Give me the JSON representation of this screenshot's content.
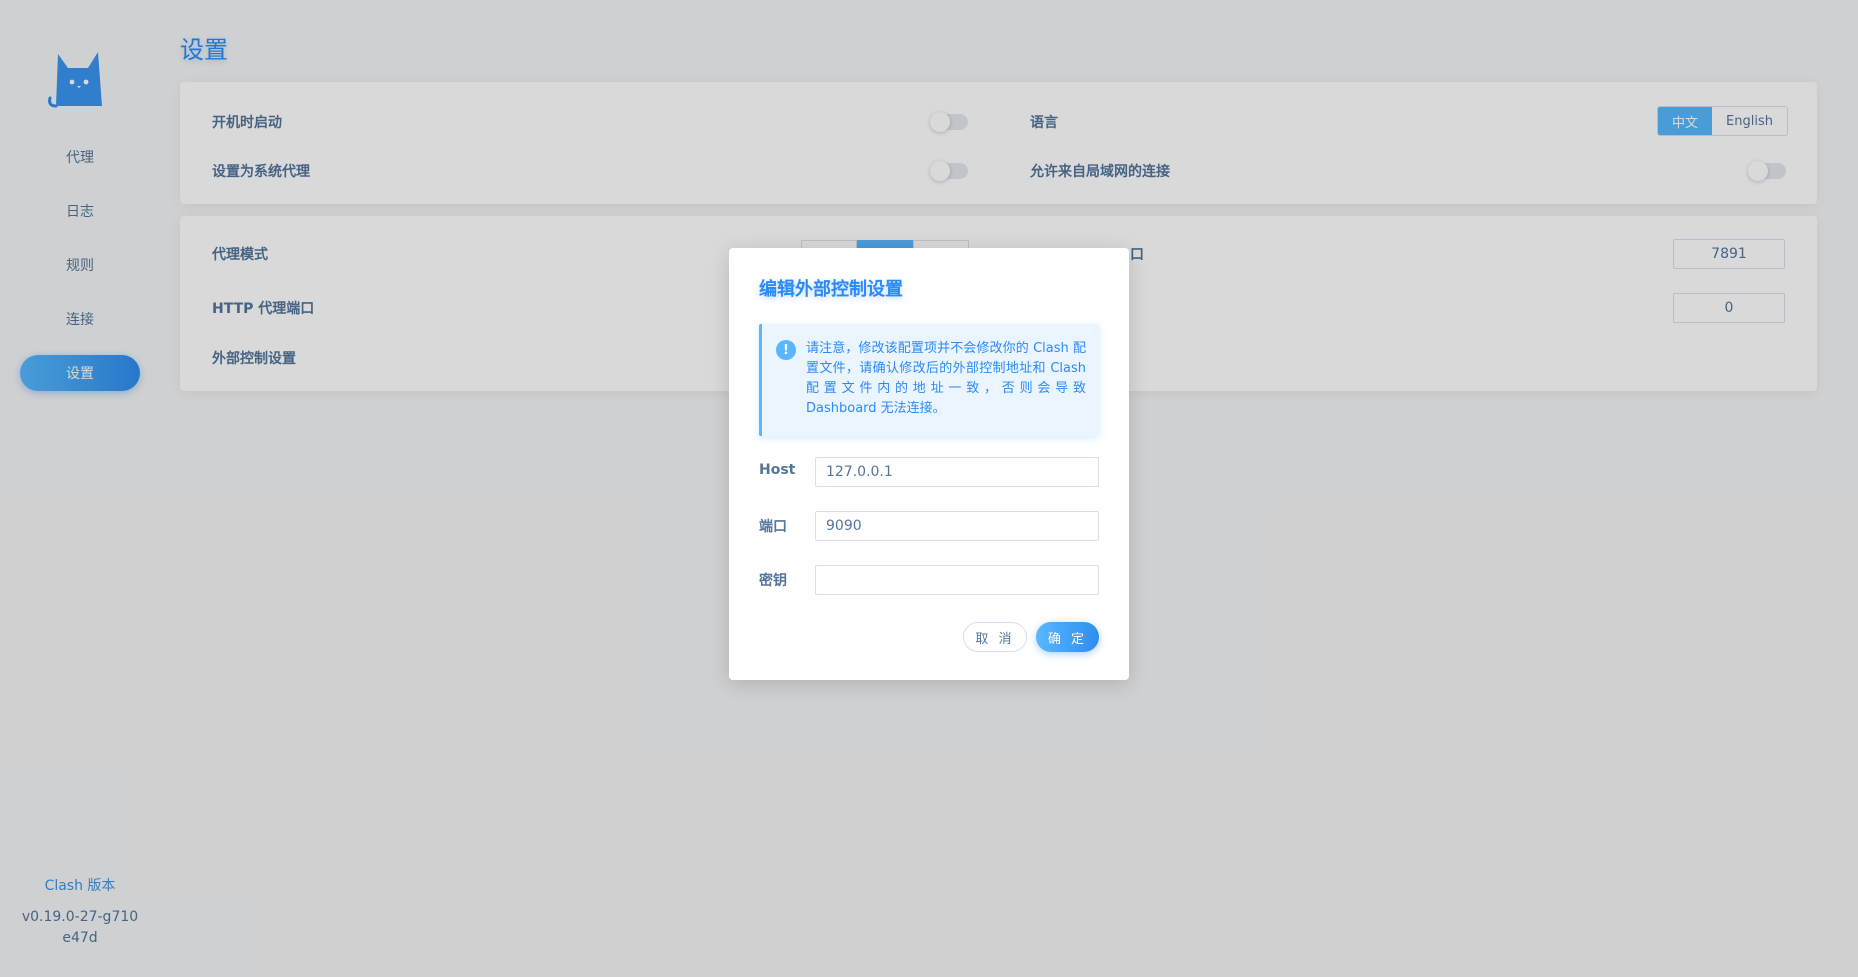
{
  "app": {
    "page_title": "设置",
    "logo_icon": "cat-icon"
  },
  "sidebar": {
    "items": [
      {
        "label": "代理"
      },
      {
        "label": "日志"
      },
      {
        "label": "规则"
      },
      {
        "label": "连接"
      },
      {
        "label": "设置"
      }
    ],
    "version_label": "Clash 版本",
    "version_value": "v0.19.0-27-g710e47d"
  },
  "settings": {
    "startup_label": "开机时启动",
    "startup_enabled": false,
    "language_label": "语言",
    "language_options": [
      "中文",
      "English"
    ],
    "language_selected": "中文",
    "system_proxy_label": "设置为系统代理",
    "system_proxy_enabled": false,
    "lan_label": "允许来自局域网的连接",
    "lan_enabled": false,
    "proxy_mode_label": "代理模式",
    "socks_port_label_suffix": "口",
    "socks_port_value": "7891",
    "http_port_label": "HTTP 代理端口",
    "http_port_value": "0",
    "external_control_label": "外部控制设置"
  },
  "modal": {
    "title": "编辑外部控制设置",
    "alert_icon": "info-icon",
    "alert_text": "请注意，修改该配置项并不会修改你的 Clash 配置文件，请确认修改后的外部控制地址和 Clash 配置文件内的地址一致，否则会导致 Dashboard 无法连接。",
    "host_label": "Host",
    "host_value": "127.0.0.1",
    "port_label": "端口",
    "port_value": "9090",
    "secret_label": "密钥",
    "secret_value": "",
    "cancel_label": "取 消",
    "ok_label": "确 定"
  },
  "colors": {
    "accent": "#2c8af8",
    "accent_light": "#57b8ff",
    "text": "#54759a",
    "background": "#f4f5f6"
  }
}
